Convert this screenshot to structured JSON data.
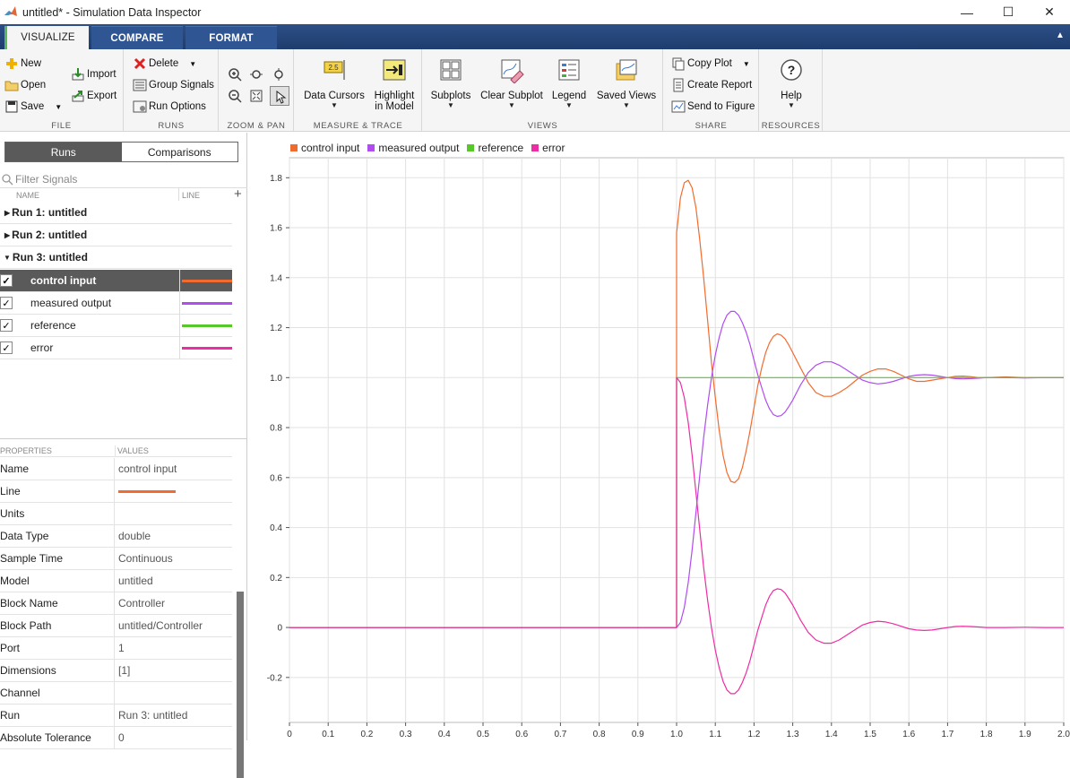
{
  "window": {
    "title": "untitled* - Simulation Data Inspector"
  },
  "tabs": [
    {
      "label": "VISUALIZE"
    },
    {
      "label": "COMPARE"
    },
    {
      "label": "FORMAT"
    }
  ],
  "ribbon": {
    "file": {
      "label": "FILE",
      "new": "New",
      "open": "Open",
      "save": "Save",
      "import": "Import",
      "export": "Export"
    },
    "runs": {
      "label": "RUNS",
      "delete": "Delete",
      "group_signals": "Group Signals",
      "run_options": "Run Options"
    },
    "zoom": {
      "label": "ZOOM & PAN"
    },
    "measure": {
      "label": "MEASURE & TRACE",
      "data_cursors": "Data Cursors",
      "cursor_value": "2.5",
      "highlight_1": "Highlight",
      "highlight_2": "in Model"
    },
    "views": {
      "label": "VIEWS",
      "subplots": "Subplots",
      "clear_subplot": "Clear Subplot",
      "legend": "Legend",
      "saved_views": "Saved Views"
    },
    "share": {
      "label": "SHARE",
      "copy_plot": "Copy Plot",
      "create_report": "Create Report",
      "send_to_figure": "Send to Figure"
    },
    "resources": {
      "label": "RESOURCES",
      "help": "Help"
    }
  },
  "panel": {
    "seg_runs": "Runs",
    "seg_comparisons": "Comparisons",
    "filter_placeholder": "Filter Signals",
    "col_name": "NAME",
    "col_line": "LINE",
    "runs": [
      {
        "label": "Run 1: untitled"
      },
      {
        "label": "Run 2: untitled"
      },
      {
        "label": "Run 3: untitled"
      }
    ],
    "signals": [
      {
        "name": "control input",
        "color": "#f26b2e"
      },
      {
        "name": "measured output",
        "color": "#b14cf0"
      },
      {
        "name": "reference",
        "color": "#56c82a"
      },
      {
        "name": "error",
        "color": "#ee2ca4"
      }
    ],
    "prop_header": "PROPERTIES",
    "val_header": "VALUES",
    "properties": [
      {
        "k": "Name",
        "v": "control input"
      },
      {
        "k": "Line",
        "v": ""
      },
      {
        "k": "Units",
        "v": ""
      },
      {
        "k": "Data Type",
        "v": "double"
      },
      {
        "k": "Sample Time",
        "v": "Continuous"
      },
      {
        "k": "Model",
        "v": "untitled"
      },
      {
        "k": "Block Name",
        "v": "Controller"
      },
      {
        "k": "Block Path",
        "v": "untitled/Controller"
      },
      {
        "k": "Port",
        "v": "1"
      },
      {
        "k": "Dimensions",
        "v": "[1]"
      },
      {
        "k": "Channel",
        "v": ""
      },
      {
        "k": "Run",
        "v": "Run 3: untitled"
      },
      {
        "k": "Absolute Tolerance",
        "v": "0"
      }
    ]
  },
  "chart_data": {
    "type": "line",
    "title": "",
    "xlabel": "",
    "ylabel": "",
    "xlim": [
      0,
      2.0
    ],
    "ylim": [
      -0.38,
      1.88
    ],
    "grid": true,
    "legend_position": "top-left",
    "xticks": [
      "0",
      "0.1",
      "0.2",
      "0.3",
      "0.4",
      "0.5",
      "0.6",
      "0.7",
      "0.8",
      "0.9",
      "1.0",
      "1.1",
      "1.2",
      "1.3",
      "1.4",
      "1.5",
      "1.6",
      "1.7",
      "1.8",
      "1.9",
      "2.0"
    ],
    "yticks": [
      "-0.2",
      "0",
      "0.2",
      "0.4",
      "0.6",
      "0.8",
      "1.0",
      "1.2",
      "1.4",
      "1.6",
      "1.8"
    ],
    "series": [
      {
        "name": "control input",
        "color": "#f26b2e",
        "x": [
          0,
          1.0,
          1.0,
          1.01,
          1.02,
          1.03,
          1.04,
          1.05,
          1.06,
          1.07,
          1.08,
          1.09,
          1.1,
          1.11,
          1.12,
          1.13,
          1.14,
          1.15,
          1.16,
          1.17,
          1.18,
          1.19,
          1.2,
          1.21,
          1.22,
          1.23,
          1.24,
          1.25,
          1.26,
          1.27,
          1.28,
          1.29,
          1.3,
          1.31,
          1.32,
          1.33,
          1.34,
          1.35,
          1.36,
          1.38,
          1.4,
          1.42,
          1.44,
          1.46,
          1.48,
          1.5,
          1.52,
          1.54,
          1.56,
          1.58,
          1.6,
          1.62,
          1.64,
          1.66,
          1.68,
          1.7,
          1.72,
          1.74,
          1.76,
          1.78,
          1.8,
          1.85,
          1.9,
          1.95,
          2.0
        ],
        "y": [
          0,
          0,
          1.58,
          1.72,
          1.78,
          1.79,
          1.76,
          1.68,
          1.55,
          1.4,
          1.23,
          1.06,
          0.92,
          0.79,
          0.69,
          0.62,
          0.585,
          0.58,
          0.595,
          0.64,
          0.71,
          0.79,
          0.88,
          0.97,
          1.04,
          1.1,
          1.14,
          1.165,
          1.175,
          1.17,
          1.155,
          1.13,
          1.1,
          1.07,
          1.04,
          1.01,
          0.98,
          0.96,
          0.94,
          0.925,
          0.925,
          0.94,
          0.96,
          0.985,
          1.01,
          1.025,
          1.035,
          1.035,
          1.025,
          1.01,
          0.995,
          0.985,
          0.985,
          0.99,
          0.995,
          1.0,
          1.005,
          1.006,
          1.004,
          1.0,
          1.0,
          1.003,
          1.0,
          1.0,
          1.0
        ]
      },
      {
        "name": "measured output",
        "color": "#b14cf0",
        "x": [
          0,
          1.0,
          1.01,
          1.02,
          1.03,
          1.04,
          1.05,
          1.06,
          1.07,
          1.08,
          1.09,
          1.1,
          1.11,
          1.12,
          1.13,
          1.14,
          1.15,
          1.16,
          1.17,
          1.18,
          1.19,
          1.2,
          1.21,
          1.22,
          1.23,
          1.24,
          1.25,
          1.26,
          1.27,
          1.28,
          1.29,
          1.3,
          1.31,
          1.32,
          1.33,
          1.34,
          1.36,
          1.38,
          1.4,
          1.42,
          1.44,
          1.46,
          1.48,
          1.5,
          1.52,
          1.54,
          1.56,
          1.58,
          1.6,
          1.62,
          1.64,
          1.66,
          1.68,
          1.7,
          1.72,
          1.74,
          1.76,
          1.78,
          1.8,
          1.85,
          1.9,
          1.95,
          2.0
        ],
        "y": [
          0,
          0,
          0.02,
          0.08,
          0.18,
          0.31,
          0.46,
          0.61,
          0.76,
          0.89,
          1.0,
          1.09,
          1.16,
          1.215,
          1.25,
          1.265,
          1.265,
          1.25,
          1.22,
          1.18,
          1.13,
          1.07,
          1.01,
          0.96,
          0.91,
          0.875,
          0.852,
          0.845,
          0.848,
          0.862,
          0.885,
          0.91,
          0.94,
          0.97,
          0.995,
          1.02,
          1.05,
          1.063,
          1.063,
          1.05,
          1.03,
          1.01,
          0.99,
          0.98,
          0.975,
          0.978,
          0.985,
          0.995,
          1.005,
          1.01,
          1.012,
          1.01,
          1.005,
          1.0,
          0.996,
          0.995,
          0.996,
          0.998,
          1.0,
          1.0,
          0.999,
          1.0,
          1.0
        ]
      },
      {
        "name": "reference",
        "color": "#56c82a",
        "x": [
          0,
          1.0,
          1.0,
          2.0
        ],
        "y": [
          0,
          0,
          1.0,
          1.0
        ]
      },
      {
        "name": "error",
        "color": "#ee2ca4",
        "x": [
          0,
          1.0,
          1.0,
          1.01,
          1.02,
          1.03,
          1.04,
          1.05,
          1.06,
          1.07,
          1.08,
          1.09,
          1.1,
          1.11,
          1.12,
          1.13,
          1.14,
          1.15,
          1.16,
          1.17,
          1.18,
          1.19,
          1.2,
          1.21,
          1.22,
          1.23,
          1.24,
          1.25,
          1.26,
          1.27,
          1.28,
          1.29,
          1.3,
          1.31,
          1.32,
          1.33,
          1.34,
          1.36,
          1.38,
          1.4,
          1.42,
          1.44,
          1.46,
          1.48,
          1.5,
          1.52,
          1.54,
          1.56,
          1.58,
          1.6,
          1.62,
          1.64,
          1.66,
          1.68,
          1.7,
          1.72,
          1.74,
          1.76,
          1.78,
          1.8,
          1.85,
          1.9,
          1.95,
          2.0
        ],
        "y": [
          0,
          0,
          1.0,
          0.98,
          0.92,
          0.82,
          0.69,
          0.54,
          0.39,
          0.24,
          0.11,
          0.0,
          -0.09,
          -0.16,
          -0.215,
          -0.25,
          -0.265,
          -0.265,
          -0.25,
          -0.22,
          -0.18,
          -0.13,
          -0.07,
          -0.01,
          0.04,
          0.09,
          0.125,
          0.148,
          0.155,
          0.152,
          0.138,
          0.115,
          0.09,
          0.06,
          0.03,
          0.005,
          -0.02,
          -0.05,
          -0.063,
          -0.063,
          -0.05,
          -0.03,
          -0.01,
          0.01,
          0.02,
          0.025,
          0.022,
          0.015,
          0.005,
          -0.005,
          -0.01,
          -0.012,
          -0.01,
          -0.005,
          0.0,
          0.004,
          0.005,
          0.004,
          0.002,
          0.0,
          0.0,
          0.001,
          0.0,
          0.0
        ]
      }
    ]
  }
}
